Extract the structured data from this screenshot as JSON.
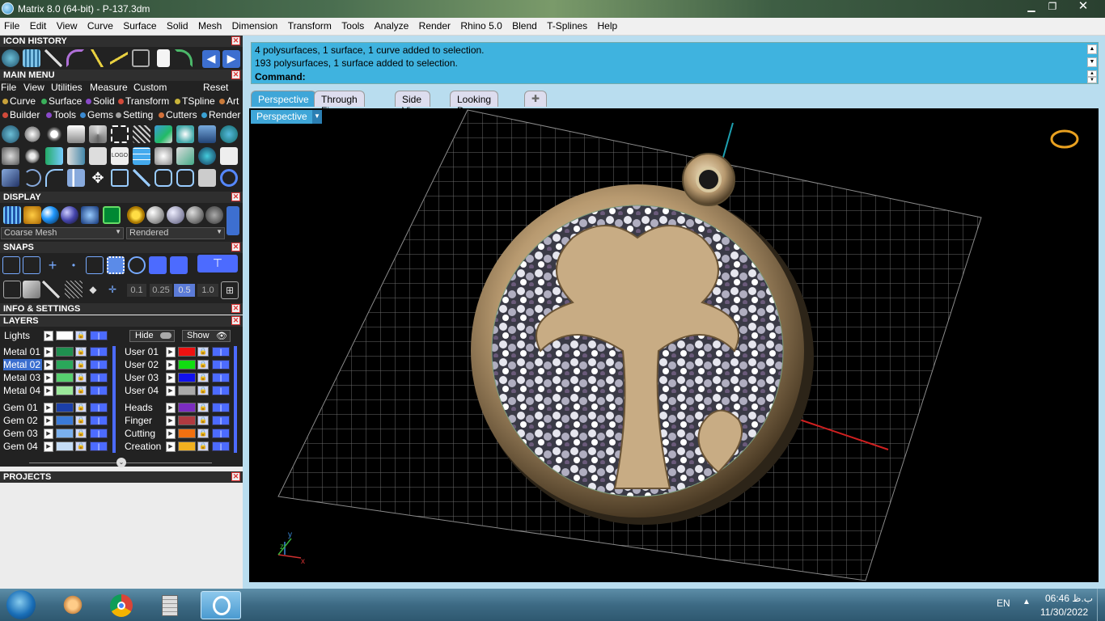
{
  "window": {
    "title": "Matrix 8.0 (64-bit) - P-137.3dm"
  },
  "menubar": [
    "File",
    "Edit",
    "View",
    "Curve",
    "Surface",
    "Solid",
    "Mesh",
    "Dimension",
    "Transform",
    "Tools",
    "Analyze",
    "Render",
    "Rhino 5.0",
    "Blend",
    "T-Splines",
    "Help"
  ],
  "panels": {
    "icon_history": "ICON HISTORY",
    "main_menu": "MAIN MENU",
    "display": "DISPLAY",
    "snaps": "SNAPS",
    "info": "INFO & SETTINGS",
    "layers": "LAYERS",
    "projects": "PROJECTS"
  },
  "main_menu": {
    "top": [
      "File",
      "View",
      "Utilities",
      "Measure",
      "Custom"
    ],
    "reset": "Reset",
    "row1": [
      {
        "label": "Curve",
        "color": "#c9a23a"
      },
      {
        "label": "Surface",
        "color": "#3ab05a"
      },
      {
        "label": "Solid",
        "color": "#8a4ac9"
      },
      {
        "label": "Transform",
        "color": "#d24a3a"
      },
      {
        "label": "TSpline",
        "color": "#c9b43a"
      },
      {
        "label": "Art",
        "color": "#c97a3a"
      }
    ],
    "row2": [
      {
        "label": "Builder",
        "color": "#d24a3a"
      },
      {
        "label": "Tools",
        "color": "#8a4ac9"
      },
      {
        "label": "Gems",
        "color": "#3a8ad2"
      },
      {
        "label": "Setting",
        "color": "#a0a0a0"
      },
      {
        "label": "Cutters",
        "color": "#d2703a"
      },
      {
        "label": "Render",
        "color": "#3aa0d2"
      }
    ]
  },
  "display": {
    "mesh": "Coarse Mesh",
    "mode": "Rendered"
  },
  "snaps": {
    "values": [
      "0.1",
      "0.25",
      "0.5",
      "1.0"
    ]
  },
  "layers": {
    "lights": "Lights",
    "hide": "Hide",
    "show": "Show",
    "left": [
      {
        "name": "Metal 01",
        "color": "#1f8f4f"
      },
      {
        "name": "Metal 02",
        "color": "#2aa85a"
      },
      {
        "name": "Metal 03",
        "color": "#56cf6e"
      },
      {
        "name": "Metal 04",
        "color": "#9be89a"
      },
      {
        "name": "Gem 01",
        "color": "#1b3fa8"
      },
      {
        "name": "Gem 02",
        "color": "#3a7ad8"
      },
      {
        "name": "Gem 03",
        "color": "#7ab0ee"
      },
      {
        "name": "Gem 04",
        "color": "#c4dcf6"
      }
    ],
    "right": [
      {
        "name": "User 01",
        "color": "#ee1111"
      },
      {
        "name": "User 02",
        "color": "#11dd11"
      },
      {
        "name": "User 03",
        "color": "#1111ee"
      },
      {
        "name": "User 04",
        "color": "#aaaaaa"
      },
      {
        "name": "Heads",
        "color": "#7b2cc0"
      },
      {
        "name": "Finger",
        "color": "#b03a40"
      },
      {
        "name": "Cutting",
        "color": "#f07010"
      },
      {
        "name": "Creation",
        "color": "#f0b020"
      }
    ]
  },
  "command": {
    "lines": [
      "4 polysurfaces, 1 surface, 1 curve added to selection.",
      "193 polysurfaces, 1 surface added to selection."
    ],
    "prompt": "Command:"
  },
  "tabs": [
    "Perspective",
    "Through Finger",
    "Side View",
    "Looking Down"
  ],
  "viewport": {
    "label": "Perspective",
    "axis_x": "x",
    "axis_y": "y",
    "axis_z": "z"
  },
  "tray": {
    "lang": "EN",
    "time": "06:46 ب.ظ",
    "date": "11/30/2022"
  }
}
